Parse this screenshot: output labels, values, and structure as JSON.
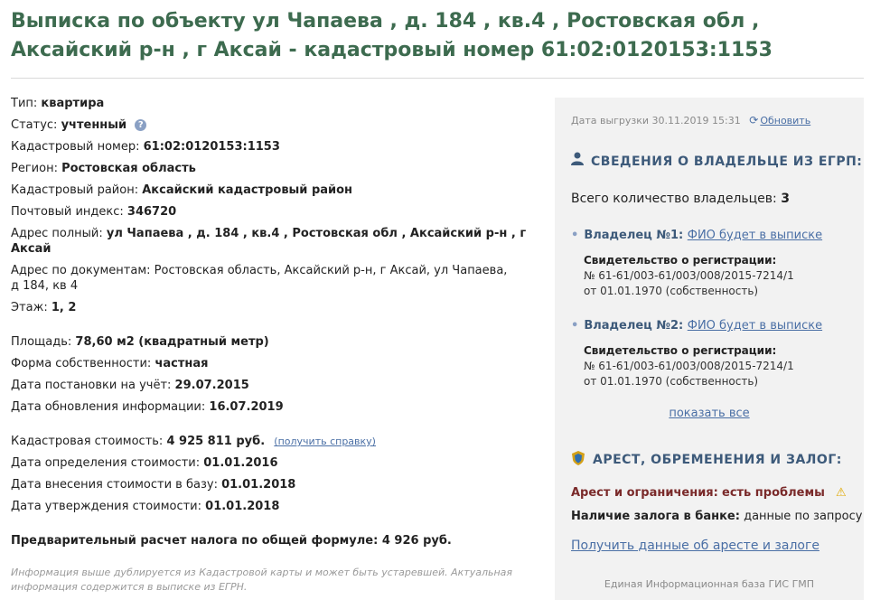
{
  "header": {
    "title": "Выписка по объекту ул Чапаева , д. 184 , кв.4 , Ростовская обл , Аксайский р-н , г Аксай - кадастровый номер 61:02:0120153:1153"
  },
  "object": {
    "type_label": "Тип:",
    "type_value": "квартира",
    "status_label": "Статус:",
    "status_value": "учтенный",
    "help_glyph": "?",
    "cadnum_label": "Кадастровый номер:",
    "cadnum_value": "61:02:0120153:1153",
    "region_label": "Регион:",
    "region_value": "Ростовская область",
    "district_label": "Кадастровый район:",
    "district_value": "Аксайский кадастровый район",
    "postcode_label": "Почтовый индекс:",
    "postcode_value": "346720",
    "address_full_label": "Адрес полный:",
    "address_full_value": "ул Чапаева , д. 184 , кв.4 , Ростовская обл , Аксайский р-н , г Аксай",
    "address_docs_label": "Адрес по документам:",
    "address_docs_value": "Ростовская область, Аксайский р-н, г Аксай, ул Чапаева, д 184, кв 4",
    "floor_label": "Этаж:",
    "floor_value": "1, 2",
    "area_label": "Площадь:",
    "area_value": "78,60 м2 (квадратный метр)",
    "ownership_label": "Форма собственности:",
    "ownership_value": "частная",
    "registered_label": "Дата постановки на учёт:",
    "registered_value": "29.07.2015",
    "updated_label": "Дата обновления информации:",
    "updated_value": "16.07.2019",
    "cost_label": "Кадастровая стоимость:",
    "cost_value": "4 925 811 руб.",
    "cost_link": "(получить справку)",
    "cost_def_label": "Дата определения стоимости:",
    "cost_def_value": "01.01.2016",
    "cost_entry_label": "Дата внесения стоимости в базу:",
    "cost_entry_value": "01.01.2018",
    "cost_approve_label": "Дата утверждения стоимости:",
    "cost_approve_value": "01.01.2018",
    "tax_text": "Предварительный расчет налога по общей формуле: 4 926 руб.",
    "note": "Информация выше дублируется из Кадастровой карты и может быть устаревшей. Актуальная информация содержится в выписке из ЕГРН."
  },
  "panel": {
    "export_date": "Дата выгрузки 30.11.2019 15:31",
    "refresh_label": "Обновить",
    "owners_title": "СВЕДЕНИЯ О ВЛАДЕЛЬЦЕ ИЗ ЕГРП:",
    "owners_count_label": "Всего количество владельцев:",
    "owners_count": "3",
    "owners": [
      {
        "title": "Владелец №1:",
        "name_link": "ФИО будет в выписке",
        "cert_title": "Свидетельство о регистрации:",
        "cert_num": "№ 61-61/003-61/003/008/2015-7214/1",
        "cert_date": "от 01.01.1970 (собственность)"
      },
      {
        "title": "Владелец №2:",
        "name_link": "ФИО будет в выписке",
        "cert_title": "Свидетельство о регистрации:",
        "cert_num": "№ 61-61/003-61/003/008/2015-7214/1",
        "cert_date": "от 01.01.1970 (собственность)"
      }
    ],
    "show_all": "показать все",
    "arrest_title": "АРЕСТ, ОБРЕМЕНЕНИЯ И ЗАЛОГ:",
    "arrest_label": "Арест и ограничения:",
    "arrest_value": "есть проблемы",
    "pledge_label": "Наличие залога в банке:",
    "pledge_value": "данные по запросу",
    "arrest_link": "Получить данные об аресте и залоге",
    "footer": "Единая Информационная база ГИС ГМП"
  }
}
